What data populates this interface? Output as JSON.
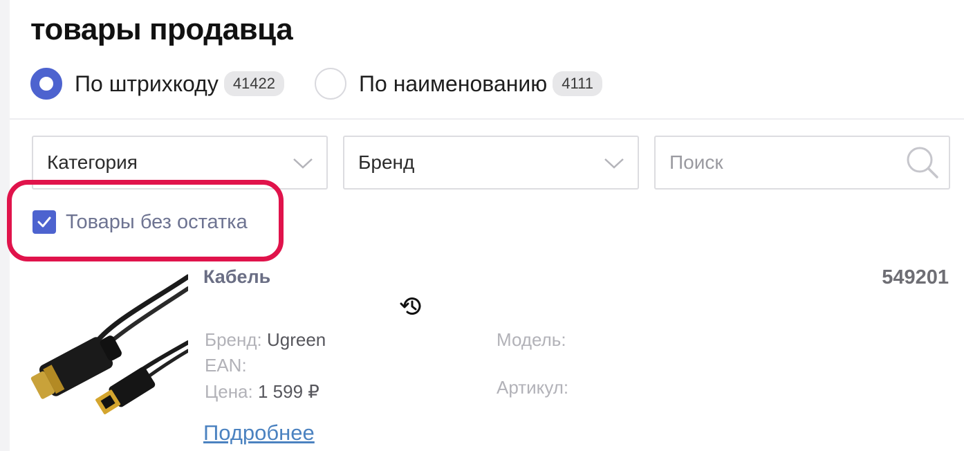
{
  "page": {
    "title": "товары продавца"
  },
  "search_mode": {
    "options": [
      {
        "label": "По штрихкоду",
        "count": "41422",
        "selected": true
      },
      {
        "label": "По наименованию",
        "count": "4111",
        "selected": false
      }
    ]
  },
  "filters": {
    "category": {
      "value": "Категория"
    },
    "brand": {
      "value": "Бренд"
    },
    "search": {
      "placeholder": "Поиск"
    }
  },
  "out_of_stock_checkbox": {
    "label": "Товары без остатка",
    "checked": true
  },
  "product": {
    "name": "Кабель",
    "id": "549201",
    "brand_label": "Бренд:",
    "brand_value": "Ugreen",
    "ean_label": "EAN:",
    "ean_value": "",
    "price_label": "Цена:",
    "price_value": "1 599 ₽",
    "model_label": "Модель:",
    "model_value": "",
    "article_label": "Артикул:",
    "article_value": "",
    "more_link": "Подробнее"
  },
  "colors": {
    "accent": "#4d63cf",
    "highlight": "#e0134b",
    "link": "#4b82c0"
  },
  "icons": [
    "chevron-down-icon",
    "search-icon",
    "check-icon",
    "history-icon"
  ]
}
